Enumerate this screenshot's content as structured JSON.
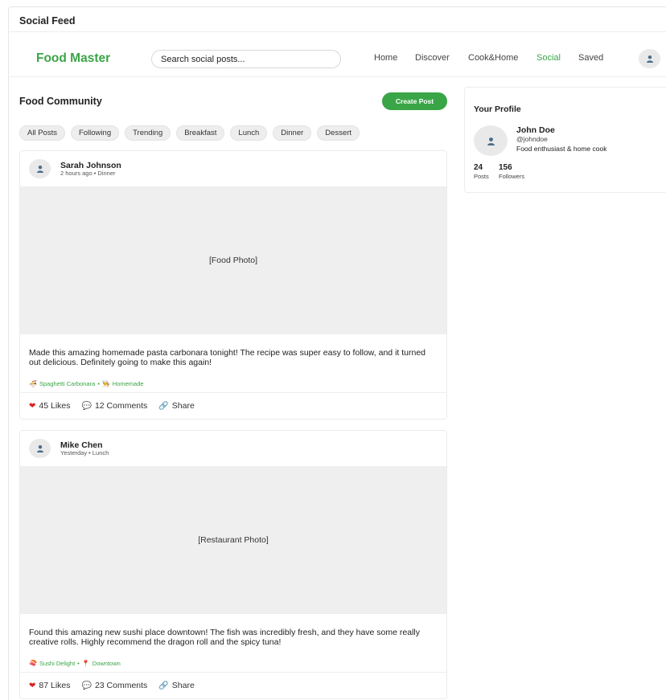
{
  "window": {
    "title": "Social Feed"
  },
  "navbar": {
    "brand": "Food Master",
    "search_placeholder": "Search social posts...",
    "links": [
      {
        "label": "Home"
      },
      {
        "label": "Discover"
      },
      {
        "label": "Cook&Home"
      },
      {
        "label": "Social",
        "active": true
      },
      {
        "label": "Saved"
      }
    ],
    "avatar_icon": "user-icon"
  },
  "feed": {
    "title": "Food Community",
    "create_label": "Create Post",
    "filters": [
      "All Posts",
      "Following",
      "Trending",
      "Breakfast",
      "Lunch",
      "Dinner",
      "Dessert"
    ],
    "posts": [
      {
        "author": "Sarah Johnson",
        "meta": "2 hours ago • Dinner",
        "photo": "[Food Photo]",
        "text": "Made this amazing homemade pasta carbonara tonight! The recipe was super easy to follow, and it turned out delicious. Definitely going to make this again!",
        "tag1": "Spaghetti Carbonara",
        "tag_sep": "•",
        "tag2": "Homemade",
        "tag1_icon": "noodle-bowl-icon",
        "tag2_icon": "chef-icon",
        "likes": "45 Likes",
        "comments": "12 Comments",
        "share": "Share"
      },
      {
        "author": "Mike Chen",
        "meta": "Yesterday • Lunch",
        "photo": "[Restaurant Photo]",
        "text": "Found this amazing new sushi place downtown! The fish was incredibly fresh, and they have some really creative rolls. Highly recommend the dragon roll and the spicy tuna!",
        "tag1": "Sushi Delight",
        "tag_sep": "•",
        "tag2": "Downtown",
        "tag1_icon": "sushi-icon",
        "tag2_icon": "pin-icon",
        "likes": "87 Likes",
        "comments": "23 Comments",
        "share": "Share"
      }
    ]
  },
  "profile": {
    "heading": "Your Profile",
    "name": "John Doe",
    "handle": "@johndoe",
    "bio": "Food enthusiast & home cook",
    "posts_count": "24",
    "posts_label": "Posts",
    "followers_count": "156",
    "followers_label": "Followers"
  },
  "colors": {
    "accent": "#3aa547",
    "like": "#dd2222",
    "photo_bg": "#efefef"
  }
}
